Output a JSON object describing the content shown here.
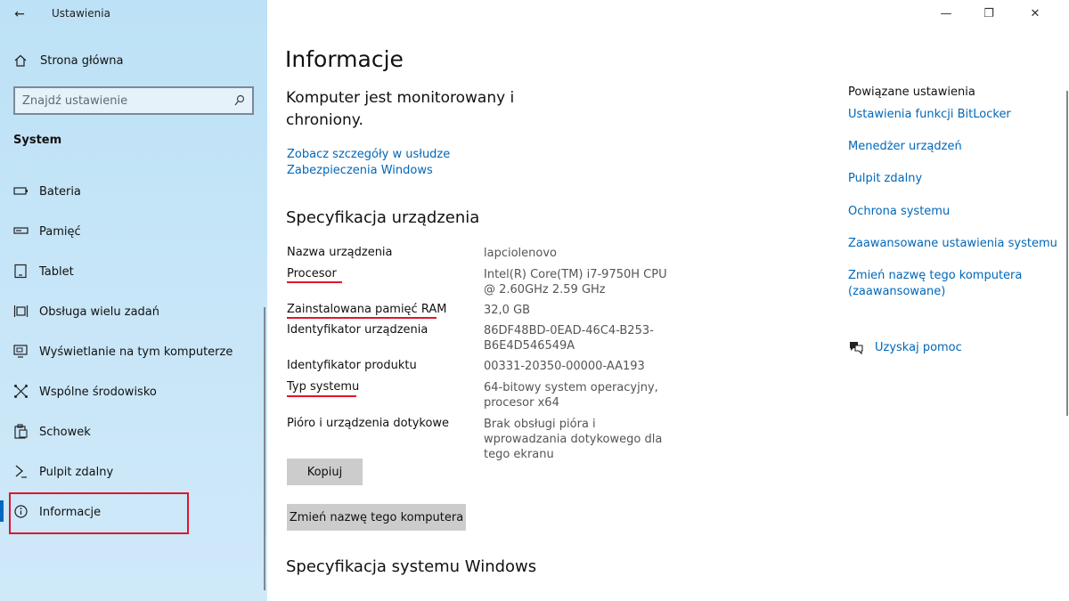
{
  "window": {
    "app_title": "Ustawienia",
    "back_icon": "←",
    "minimize_icon": "—",
    "maximize_icon": "❐",
    "close_icon": "✕"
  },
  "sidebar": {
    "home_label": "Strona główna",
    "search_placeholder": "Znajdź ustawienie",
    "section_label": "System",
    "items": [
      {
        "label": "Bateria",
        "icon": "battery-icon"
      },
      {
        "label": "Pamięć",
        "icon": "storage-icon"
      },
      {
        "label": "Tablet",
        "icon": "tablet-icon"
      },
      {
        "label": "Obsługa wielu zadań",
        "icon": "multitasking-icon"
      },
      {
        "label": "Wyświetlanie na tym komputerze",
        "icon": "projecting-icon"
      },
      {
        "label": "Wspólne środowisko",
        "icon": "shared-experiences-icon"
      },
      {
        "label": "Schowek",
        "icon": "clipboard-icon"
      },
      {
        "label": "Pulpit zdalny",
        "icon": "remote-desktop-icon"
      },
      {
        "label": "Informacje",
        "icon": "info-icon",
        "active": true
      }
    ]
  },
  "main": {
    "title": "Informacje",
    "protection_text": "Komputer jest monitorowany i chroniony.",
    "protection_link": "Zobacz szczegóły w usłudze Zabezpieczenia Windows",
    "device_spec_title": "Specyfikacja urządzenia",
    "specs": [
      {
        "label": "Nazwa urządzenia",
        "value": "lapciolenovo"
      },
      {
        "label": "Procesor",
        "value": "Intel(R) Core(TM) i7-9750H CPU @ 2.60GHz   2.59 GHz"
      },
      {
        "label": "Zainstalowana pamięć RAM",
        "value": "32,0 GB"
      },
      {
        "label": "Identyfikator urządzenia",
        "value": "86DF48BD-0EAD-46C4-B253-B6E4D546549A"
      },
      {
        "label": "Identyfikator produktu",
        "value": "00331-20350-00000-AA193"
      },
      {
        "label": "Typ systemu",
        "value": "64-bitowy system operacyjny, procesor x64"
      },
      {
        "label": "Pióro i urządzenia dotykowe",
        "value": "Brak obsługi pióra i wprowadzania dotykowego dla tego ekranu"
      }
    ],
    "copy_button": "Kopiuj",
    "rename_button": "Zmień nazwę tego komputera",
    "windows_spec_title": "Specyfikacja systemu Windows"
  },
  "related": {
    "title": "Powiązane ustawienia",
    "links": [
      "Ustawienia funkcji BitLocker",
      "Menedżer urządzeń",
      "Pulpit zdalny",
      "Ochrona systemu",
      "Zaawansowane ustawienia systemu",
      "Zmień nazwę tego komputera (zaawansowane)"
    ],
    "help_label": "Uzyskaj pomoc"
  },
  "colors": {
    "accent": "#0067b8",
    "annotation_red": "#e0162b",
    "sidebar_bg": "#c8e6f8"
  }
}
